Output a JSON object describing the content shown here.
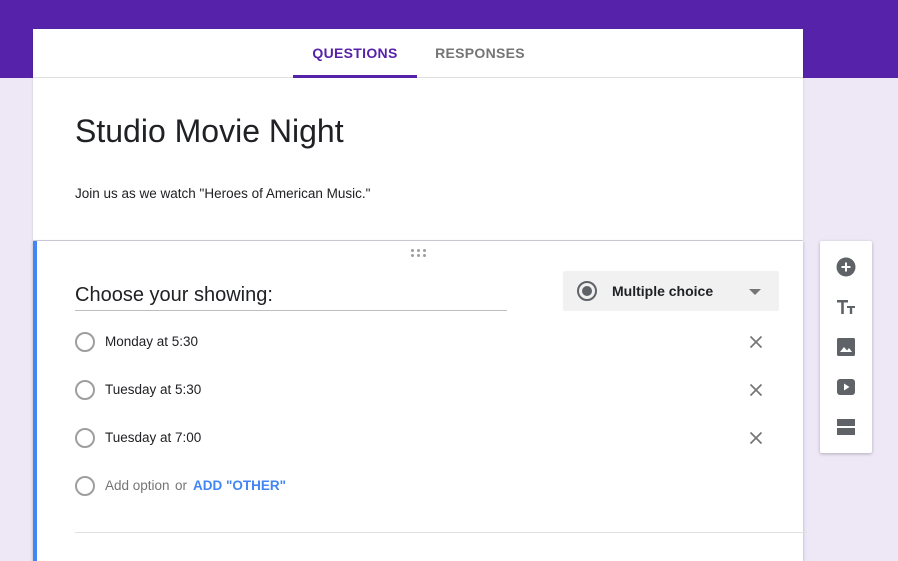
{
  "tabs": {
    "questions": "QUESTIONS",
    "responses": "RESPONSES"
  },
  "form": {
    "title": "Studio Movie Night",
    "description": "Join us as we watch \"Heroes of American Music.\""
  },
  "question": {
    "title": "Choose your showing:",
    "type": "Multiple choice",
    "options": [
      "Monday at 5:30",
      "Tuesday at 5:30",
      "Tuesday at 7:00"
    ],
    "add_option": "Add option",
    "or": "or",
    "add_other": "ADD \"OTHER\""
  },
  "colors": {
    "brand": "#5622a9",
    "accent": "#4285f4",
    "background": "#ede7f6"
  },
  "toolbar_icons": [
    "add-question-icon",
    "title-text-icon",
    "image-icon",
    "video-icon",
    "section-icon"
  ]
}
